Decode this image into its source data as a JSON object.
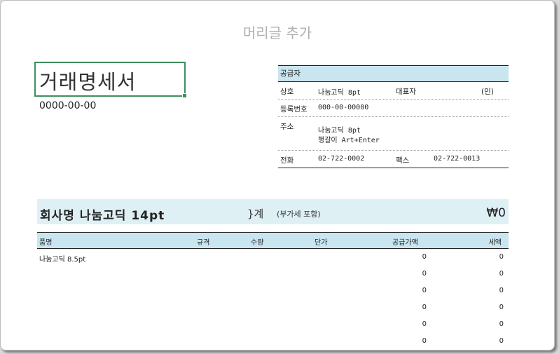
{
  "header": {
    "placeholder": "머리글 추가"
  },
  "document": {
    "title": "거래명세서",
    "date": "0000-00-00"
  },
  "supplier": {
    "header": "공급자",
    "company_label": "상호",
    "company_value": "나눔고딕 8pt",
    "ceo_label": "대표자",
    "ceo_seal": "(인)",
    "reg_label": "등록번호",
    "reg_value": "000-00-00000",
    "address_label": "주소",
    "address_line1": "나눔고딕 8pt",
    "address_line2": "행갈이 Art+Enter",
    "phone_label": "전화",
    "phone_value": "02-722-0002",
    "fax_label": "팩스",
    "fax_value": "02-722-0013"
  },
  "summary": {
    "company_name": "회사명 나눔고딕 14pt",
    "total_label": "}계",
    "total_note": "(부가세 포함)",
    "total_value": "₩0"
  },
  "items": {
    "columns": [
      "품명",
      "규격",
      "수량",
      "단가",
      "공급가액",
      "세액"
    ],
    "rows": [
      {
        "name": "나눔고딕 8.5pt",
        "supply": "0",
        "tax": "0"
      },
      {
        "name": "",
        "supply": "0",
        "tax": "0"
      },
      {
        "name": "",
        "supply": "0",
        "tax": "0"
      },
      {
        "name": "",
        "supply": "0",
        "tax": "0"
      },
      {
        "name": "",
        "supply": "0",
        "tax": "0"
      },
      {
        "name": "",
        "supply": "0",
        "tax": "0"
      }
    ]
  }
}
